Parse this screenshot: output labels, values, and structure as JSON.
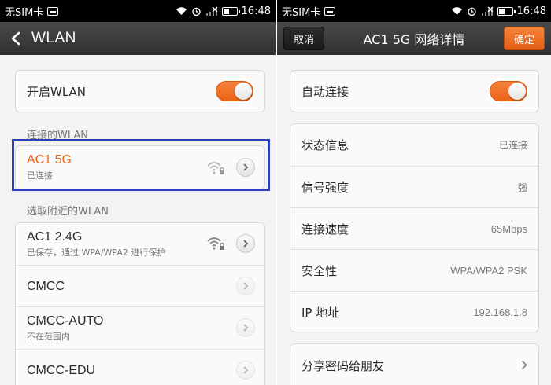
{
  "left": {
    "status": {
      "carrier": "无SIM卡",
      "time": "16:48"
    },
    "header": {
      "title": "WLAN"
    },
    "wlan_toggle": {
      "label": "开启WLAN",
      "on": true
    },
    "connected_section": {
      "header": "连接的WLAN"
    },
    "connected_network": {
      "name": "AC1 5G",
      "status": "已连接"
    },
    "nearby_section": {
      "header": "选取附近的WLAN"
    },
    "networks": [
      {
        "name": "AC1 2.4G",
        "sub": "已保存，通过 WPA/WPA2 进行保护",
        "icon": "wifi-lock-icon"
      },
      {
        "name": "CMCC",
        "sub": ""
      },
      {
        "name": "CMCC-AUTO",
        "sub": "不在范围内"
      },
      {
        "name": "CMCC-EDU",
        "sub": ""
      }
    ]
  },
  "right": {
    "status": {
      "carrier": "无SIM卡",
      "time": "16:48"
    },
    "header": {
      "title": "AC1 5G 网络详情",
      "cancel_label": "取消",
      "confirm_label": "确定"
    },
    "auto_connect": {
      "label": "自动连接",
      "on": true
    },
    "details": [
      {
        "label": "状态信息",
        "value": "已连接"
      },
      {
        "label": "信号强度",
        "value": "强"
      },
      {
        "label": "连接速度",
        "value": "65Mbps"
      },
      {
        "label": "安全性",
        "value": "WPA/WPA2 PSK"
      },
      {
        "label": "IP 地址",
        "value": "192.168.1.8"
      }
    ],
    "share": {
      "label": "分享密码给朋友"
    }
  },
  "colors": {
    "accent": "#ec6316",
    "highlight": "#2d3db5",
    "titlebar": "#3a3a3a"
  }
}
